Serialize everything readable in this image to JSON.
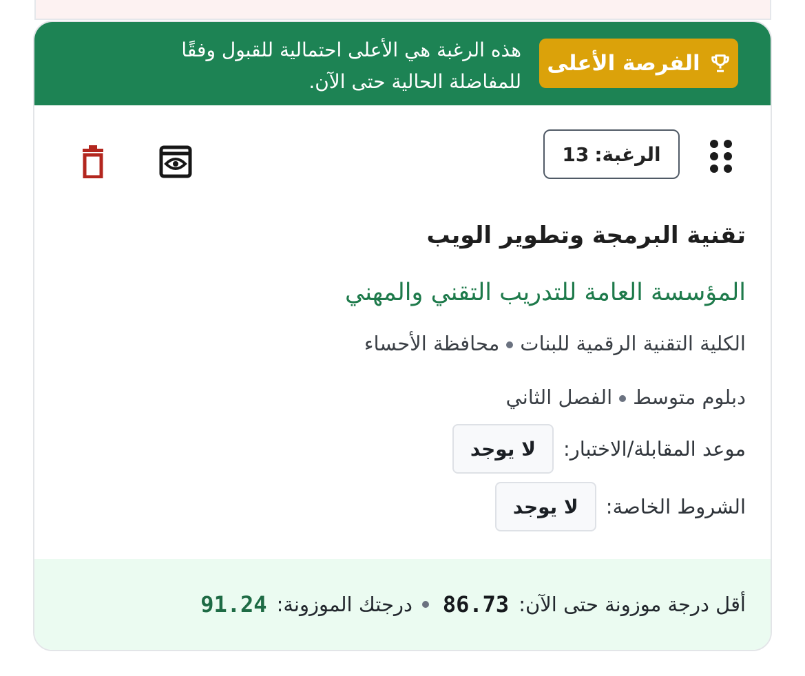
{
  "banner": {
    "badge_label": "الفرصة الأعلى",
    "message": "هذه الرغبة هي الأعلى احتمالية للقبول وفقًا للمفاضلة الحالية حتى الآن."
  },
  "toolbar": {
    "rank_label": "الرغبة:",
    "rank_value": "13"
  },
  "program": {
    "major": "تقنية البرمجة وتطوير الويب",
    "organization": "المؤسسة العامة للتدريب التقني والمهني",
    "college": "الكلية التقنية الرقمية للبنات",
    "region": "محافظة الأحساء",
    "degree": "دبلوم متوسط",
    "semester": "الفصل الثاني"
  },
  "details": {
    "interview_label": "موعد المقابلة/الاختبار:",
    "interview_value": "لا يوجد",
    "conditions_label": "الشروط الخاصة:",
    "conditions_value": "لا يوجد"
  },
  "footer": {
    "min_score_label": "أقل درجة موزونة حتى الآن:",
    "min_score_value": "86.73",
    "your_score_label": "درجتك الموزونة:",
    "your_score_value": "91.24"
  },
  "colors": {
    "banner_green": "#1d8354",
    "badge_gold": "#dba20a",
    "org_green": "#1e7a4b",
    "delete_red": "#b3261e",
    "footer_bg": "#ebfbf1"
  },
  "icons": {
    "badge": "trophy-icon",
    "drag": "drag-handle-icon",
    "view": "eye-icon",
    "delete": "trash-icon"
  }
}
